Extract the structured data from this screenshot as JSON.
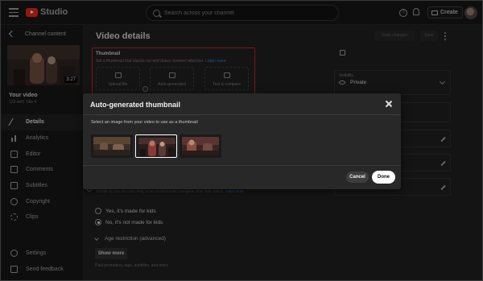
{
  "topbar": {
    "logo_text": "Studio",
    "search_placeholder": "Search across your channel",
    "create_label": "Create",
    "help_glyph": "?"
  },
  "sidebar": {
    "back_label": "Channel content",
    "duration": "3:27",
    "your_video": "Your video",
    "video_sub": "123 dof1 Title 4",
    "items": [
      {
        "label": "Details",
        "icon": "pencil-icon",
        "active": true
      },
      {
        "label": "Analytics",
        "icon": "analytics-icon"
      },
      {
        "label": "Editor",
        "icon": "editor-icon"
      },
      {
        "label": "Comments",
        "icon": "comments-icon"
      },
      {
        "label": "Subtitles",
        "icon": "subtitles-icon"
      },
      {
        "label": "Copyright",
        "icon": "copyright-icon"
      },
      {
        "label": "Clips",
        "icon": "clips-icon"
      }
    ],
    "bottom_items": [
      {
        "label": "Settings",
        "icon": "gear-icon"
      },
      {
        "label": "Send feedback",
        "icon": "feedback-icon"
      }
    ]
  },
  "main": {
    "title": "Video details",
    "undo_label": "Undo changes",
    "save_label": "Save",
    "thumbnail": {
      "title": "Thumbnail",
      "desc": "Set a thumbnail that stands out and draws viewers' attention.",
      "learn_more": "Learn more",
      "options": [
        "Upload file",
        "Auto-generated",
        "Test & compare"
      ],
      "info_glyph": "?"
    },
    "visibility": {
      "label": "Visibility",
      "value": "Private"
    },
    "kids_info": "Features like personalized ads and notifications won't be available on videos made for kids. Videos that are set as made for kids by you are more likely to be recommended alongside other kids' videos.",
    "kids_learn_more": "Learn more",
    "audience": {
      "yes_label": "Yes, it's made for kids",
      "no_label": "No, it's not made for kids",
      "selected": "no"
    },
    "age_restriction": "Age restriction (advanced)",
    "show_more": "Show more",
    "paid_promo": "Paid promotion, tags, subtitles, and more"
  },
  "dialog": {
    "title": "Auto-generated thumbnail",
    "instruction": "Select an image from your video to use as a thumbnail",
    "selected_index": 1,
    "cancel_label": "Cancel",
    "done_label": "Done"
  },
  "colors": {
    "accent_red": "#c0212a",
    "link_blue": "#3e7ed8",
    "done_bg": "#ffffff"
  }
}
